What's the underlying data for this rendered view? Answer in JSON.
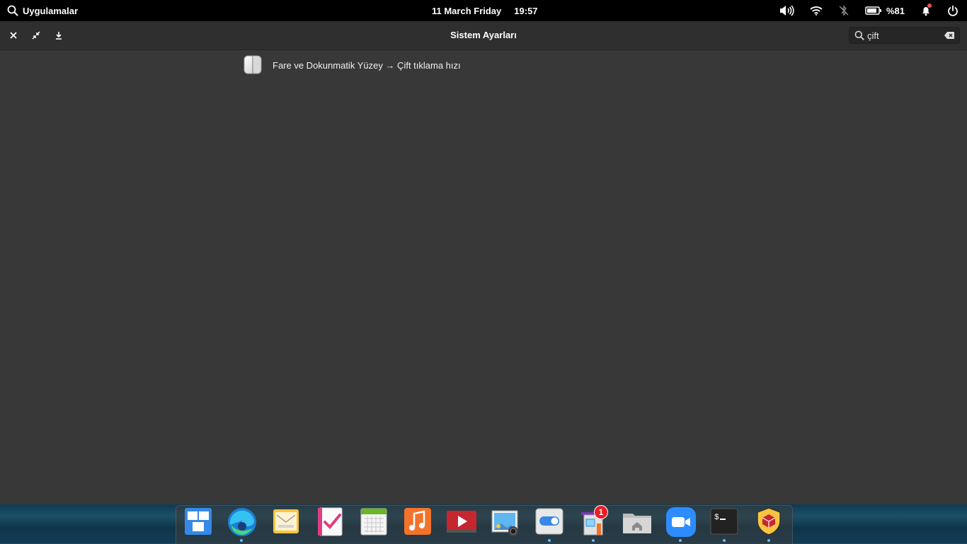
{
  "panel": {
    "apps_label": "Uygulamalar",
    "date": "11 March Friday",
    "time": "19:57",
    "battery": "%81"
  },
  "window": {
    "title": "Sistem Ayarları",
    "search": {
      "value": "çift"
    },
    "results": [
      {
        "label": "Fare ve Dokunmatik Yüzey → Çift tıklama hızı",
        "icon": "mouse-icon"
      }
    ]
  },
  "dock": {
    "items": [
      {
        "name": "multitasking-view",
        "running": false
      },
      {
        "name": "microsoft-edge",
        "running": true
      },
      {
        "name": "mail",
        "running": false
      },
      {
        "name": "tasks",
        "running": false
      },
      {
        "name": "calendar",
        "running": false
      },
      {
        "name": "music",
        "running": false
      },
      {
        "name": "videos",
        "running": false
      },
      {
        "name": "photos",
        "running": false
      },
      {
        "name": "system-settings",
        "running": true
      },
      {
        "name": "appcenter",
        "running": true,
        "badge": "1"
      },
      {
        "name": "files",
        "running": false
      },
      {
        "name": "zoom",
        "running": true
      },
      {
        "name": "terminal",
        "running": true
      },
      {
        "name": "security-app",
        "running": true
      }
    ]
  },
  "colors": {
    "accent": "#64baff",
    "panel": "#000000",
    "window": "#383838",
    "notify": "#ed5353"
  }
}
